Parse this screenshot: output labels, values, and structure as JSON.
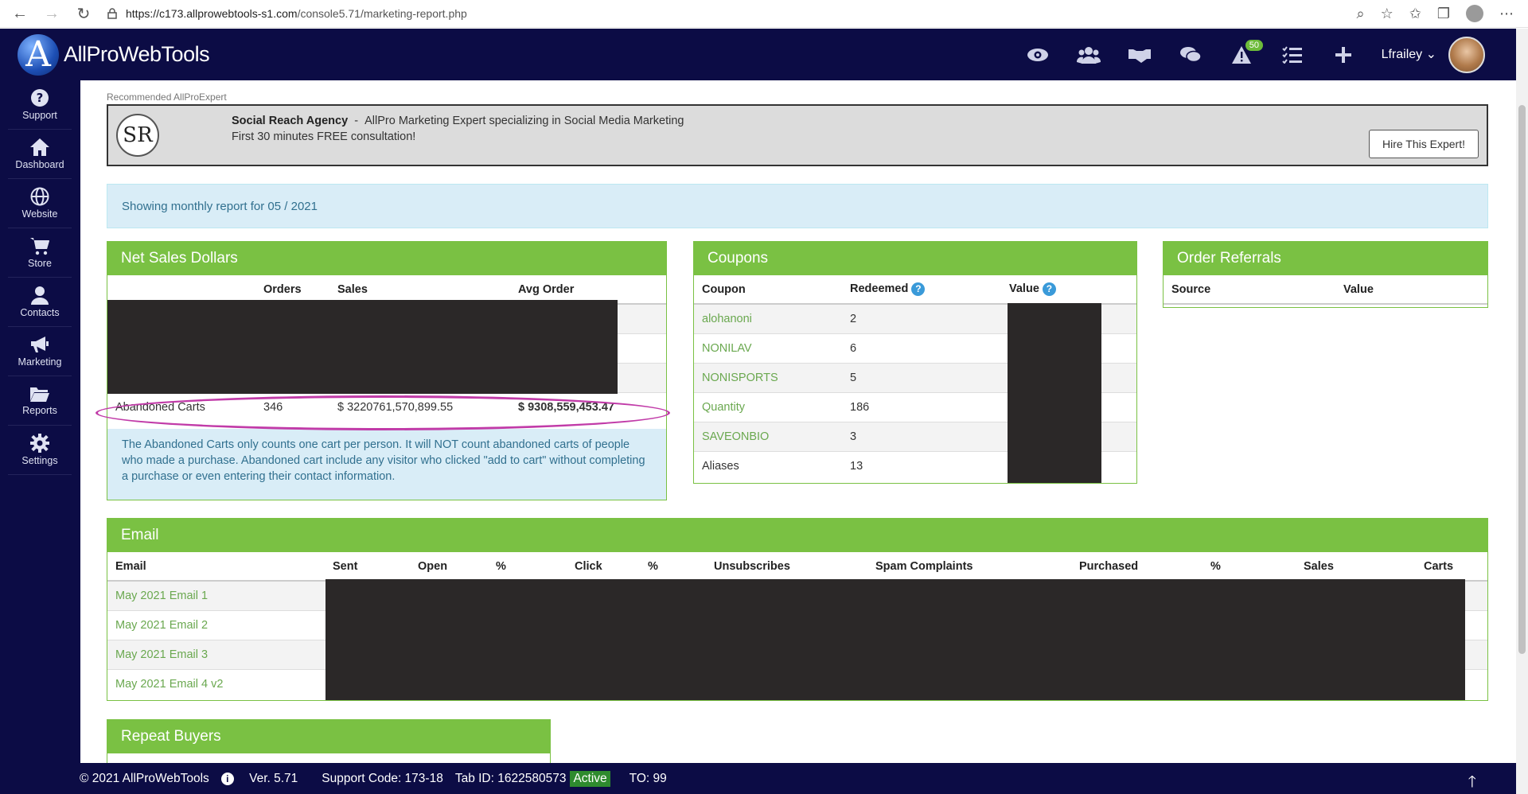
{
  "browser": {
    "url_host": "https://c173.allprowebtools-s1.com",
    "url_path": "/console5.71/marketing-report.php"
  },
  "header": {
    "brand": "AllProWebTools",
    "notifications_count": "50",
    "user_name": "Lfrailey"
  },
  "sidebar": {
    "items": [
      {
        "label": "Support",
        "icon": "question-circle-icon"
      },
      {
        "label": "Dashboard",
        "icon": "home-icon"
      },
      {
        "label": "Website",
        "icon": "globe-icon"
      },
      {
        "label": "Store",
        "icon": "cart-icon"
      },
      {
        "label": "Contacts",
        "icon": "user-icon"
      },
      {
        "label": "Marketing",
        "icon": "megaphone-icon"
      },
      {
        "label": "Reports",
        "icon": "folder-icon"
      },
      {
        "label": "Settings",
        "icon": "gear-icon"
      }
    ]
  },
  "expert": {
    "section_label": "Recommended AllProExpert",
    "logo_text": "SR",
    "name": "Social Reach Agency",
    "separator": "-",
    "tagline": "AllPro Marketing Expert specializing in Social Media Marketing",
    "offer": "First 30 minutes FREE consultation!",
    "hire_button": "Hire This Expert!"
  },
  "report_info": "Showing monthly report for 05 / 2021",
  "net_sales": {
    "title": "Net Sales Dollars",
    "columns": [
      "",
      "Orders",
      "Sales",
      "Avg Order"
    ],
    "abandoned": {
      "label": "Abandoned Carts",
      "orders": "346",
      "sales": "$ 3220761,570,899.55",
      "avg": "$ 9308,559,453.47"
    },
    "note": "The Abandoned Carts only counts one cart per person. It will NOT count abandoned carts of people who made a purchase. Abandoned cart include any visitor who clicked \"add to cart\" without completing a purchase or even entering their contact information."
  },
  "coupons": {
    "title": "Coupons",
    "columns": [
      "Coupon",
      "Redeemed",
      "Value"
    ],
    "rows": [
      {
        "name": "alohanoni",
        "redeemed": "2",
        "link": true
      },
      {
        "name": "NONILAV",
        "redeemed": "6",
        "link": true
      },
      {
        "name": "NONISPORTS",
        "redeemed": "5",
        "link": true
      },
      {
        "name": "Quantity",
        "redeemed": "186",
        "link": true
      },
      {
        "name": "SAVEONBIO",
        "redeemed": "3",
        "link": true
      },
      {
        "name": "Aliases",
        "redeemed": "13",
        "link": false
      }
    ]
  },
  "referrals": {
    "title": "Order Referrals",
    "columns": [
      "Source",
      "Value"
    ]
  },
  "email": {
    "title": "Email",
    "columns": [
      "Email",
      "Sent",
      "Open",
      "%",
      "Click",
      "%",
      "Unsubscribes",
      "Spam Complaints",
      "Purchased",
      "%",
      "Sales",
      "Carts"
    ],
    "rows": [
      "May 2021 Email 1",
      "May 2021 Email 2",
      "May 2021 Email 3",
      "May 2021 Email 4 v2"
    ]
  },
  "repeat_buyers": {
    "title": "Repeat Buyers"
  },
  "footer": {
    "copyright": "© 2021 AllProWebTools",
    "version": "Ver. 5.71",
    "support_code": "Support Code: 173-18",
    "tab_id": "Tab ID: 1622580573",
    "status": "Active",
    "to": "TO: 99"
  },
  "colors": {
    "navy": "#0c0c45",
    "green": "#7ac143",
    "info_bg": "#d9edf7",
    "highlight": "#c13ba8"
  }
}
